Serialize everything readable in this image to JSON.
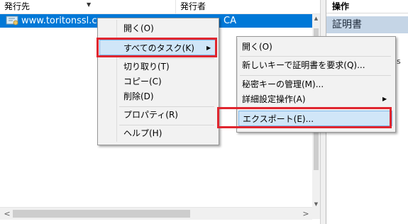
{
  "list": {
    "columns": {
      "issued_to": "発行先",
      "issued_by": "発行者"
    },
    "rows": [
      {
        "issued_to": "www.toritonssl.co",
        "issued_by": "CA"
      }
    ]
  },
  "actions": {
    "title": "操作",
    "section": "証明書",
    "partial_text": "s"
  },
  "context_menu": {
    "items": {
      "open": "開く(O)",
      "all_tasks": "すべてのタスク(K)",
      "cut": "切り取り(T)",
      "copy": "コピー(C)",
      "delete": "削除(D)",
      "properties": "プロパティ(R)",
      "help": "ヘルプ(H)"
    }
  },
  "submenu": {
    "items": {
      "open": "開く(O)",
      "request_new_key": "新しいキーで証明書を要求(Q)...",
      "manage_private_keys": "秘密キーの管理(M)...",
      "advanced": "詳細設定操作(A)",
      "export": "エクスポート(E)..."
    }
  },
  "icons": {
    "sort": "sort-descending-icon",
    "certificate": "certificate-icon",
    "submenu_arrow": "chevron-right-icon"
  },
  "colors": {
    "selection": "#0078d7",
    "menu_highlight": "#d0e6f8",
    "callout_red": "#e0262f",
    "actions_section": "#c5d5e6"
  }
}
